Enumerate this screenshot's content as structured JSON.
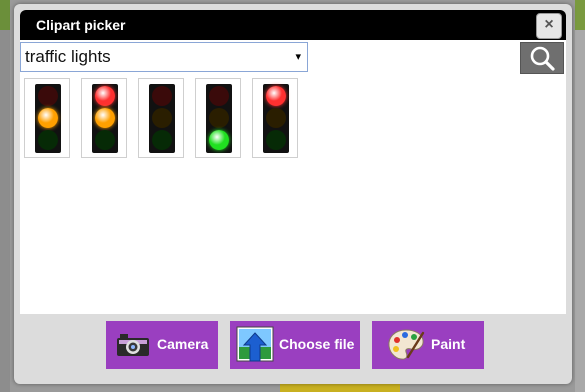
{
  "dialog": {
    "title": "Clipart picker",
    "close_label": "×"
  },
  "search": {
    "selected_value": "traffic lights",
    "dropdown_arrow": "▾",
    "search_icon": "search-icon"
  },
  "results": [
    {
      "red": "off",
      "amber": "on",
      "green": "off"
    },
    {
      "red": "on",
      "amber": "on",
      "green": "off"
    },
    {
      "red": "off",
      "amber": "off",
      "green": "off"
    },
    {
      "red": "off",
      "amber": "off",
      "green": "on"
    },
    {
      "red": "on",
      "amber": "off",
      "green": "off"
    }
  ],
  "footer": {
    "camera_label": "Camera",
    "choose_file_label": "Choose file",
    "paint_label": "Paint"
  },
  "colors": {
    "button_purple": "#9a3fc0",
    "titlebar": "#000000",
    "red_on": "#ff3030",
    "amber_on": "#ffa000",
    "green_on": "#20e020",
    "red_off": "#3a0a0a",
    "amber_off": "#2a1e00",
    "green_off": "#062a06"
  }
}
